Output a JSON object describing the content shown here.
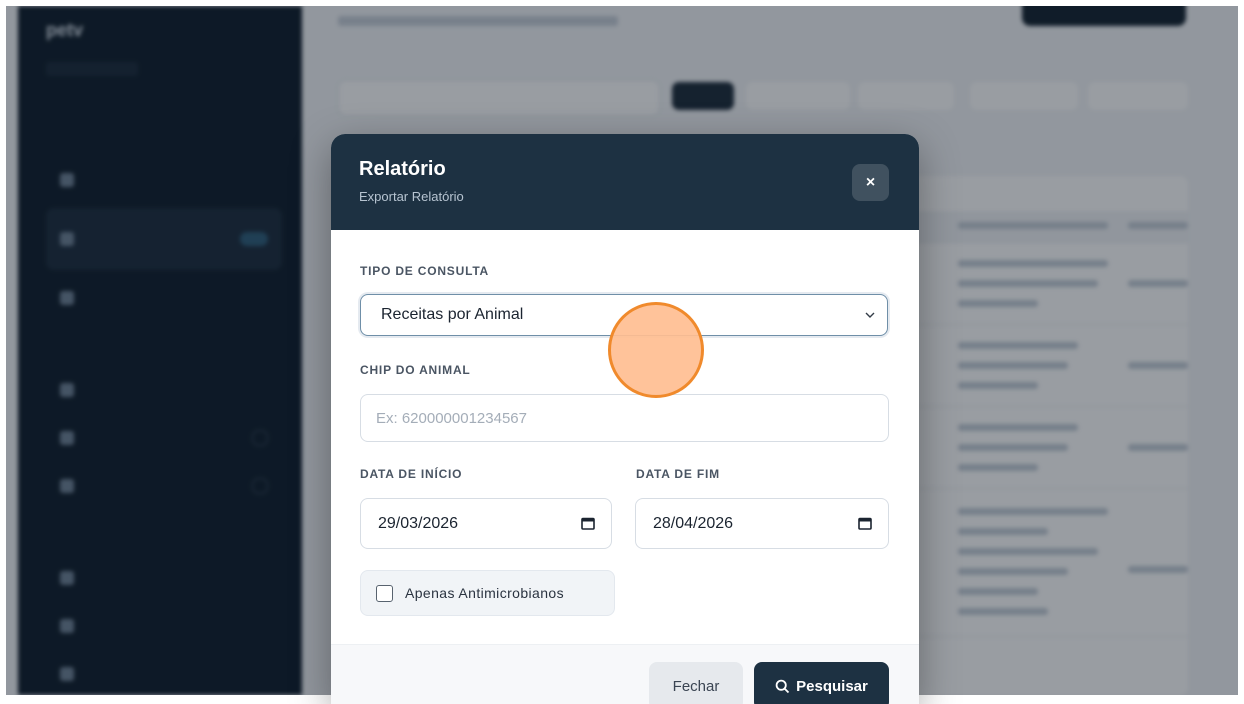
{
  "modal": {
    "title": "Relatório",
    "subtitle": "Exportar Relatório",
    "close_label": "×",
    "fields": {
      "query_type_label": "TIPO DE CONSULTA",
      "query_type_value": "Receitas por Animal",
      "chip_label": "CHIP DO ANIMAL",
      "chip_placeholder": "Ex: 620000001234567",
      "start_date_label": "DATA DE INÍCIO",
      "start_date_value": "29/03/2026",
      "end_date_label": "DATA DE FIM",
      "end_date_value": "28/04/2026",
      "antimicrobials_label": "Apenas Antimicrobianos",
      "antimicrobials_checked": false
    },
    "buttons": {
      "close": "Fechar",
      "search": "Pesquisar"
    }
  },
  "icons": {
    "close": "close-icon",
    "select_chevron": "chevron-down-icon",
    "calendar": "calendar-icon",
    "search": "search-icon"
  },
  "colors": {
    "header_bg": "#1d3142",
    "primary_button": "#1d3142",
    "touch_indicator": "#f08a2c"
  }
}
